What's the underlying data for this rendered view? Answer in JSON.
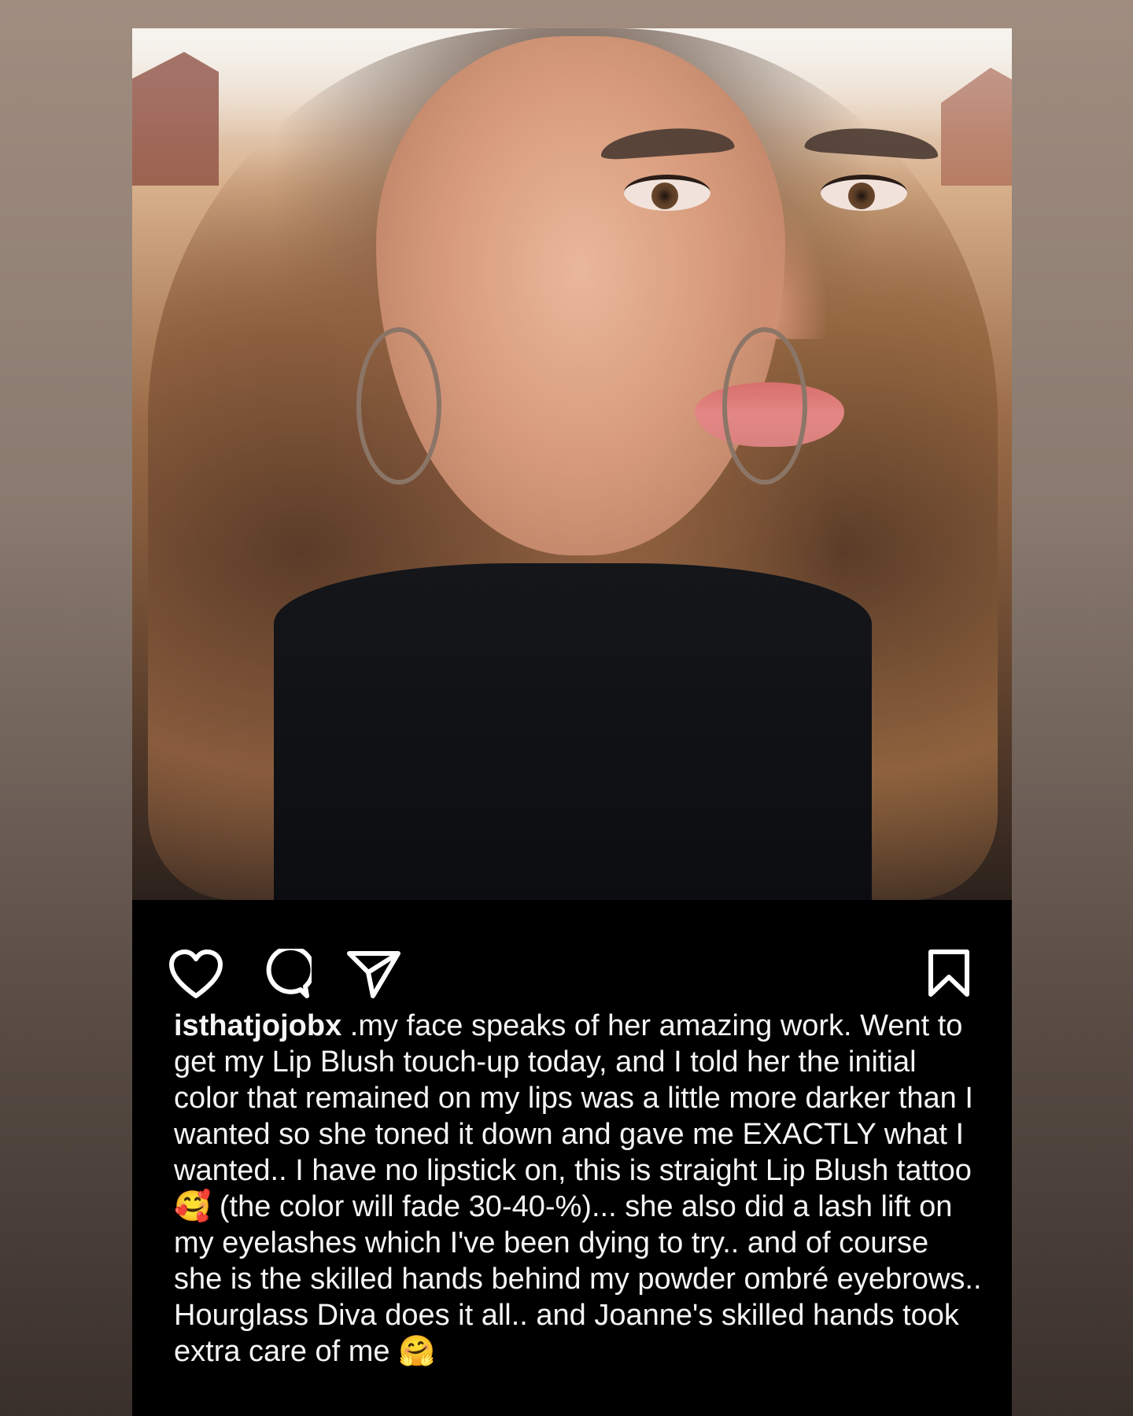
{
  "post": {
    "username": "isthatjojobx",
    "caption": " .my face speaks of her amazing work. Went to get my Lip Blush touch-up today, and I told her the initial color that remained on my lips was a little more darker than I wanted so she toned it down and gave me EXACTLY what I wanted.. I have no lipstick on, this is straight Lip Blush tattoo 🥰 (the color will fade 30-40-%)... she also did a lash lift on my eyelashes which I've been dying to try.. and of course she is the skilled hands behind my powder ombré eyebrows.. Hourglass Diva does it all.. and Joanne's skilled hands took extra care of me 🤗",
    "photo_alt": "Selfie showing lip blush, eyebrows and lash lift"
  },
  "actions": {
    "like_icon": "heart-outline-icon",
    "comment_icon": "speech-bubble-icon",
    "share_icon": "paper-plane-icon",
    "save_icon": "bookmark-outline-icon"
  },
  "colors": {
    "page_bg_top": "#a08d80",
    "page_bg_bottom": "#3a302b",
    "card_bg": "#000000",
    "text": "#f5f5f5"
  }
}
